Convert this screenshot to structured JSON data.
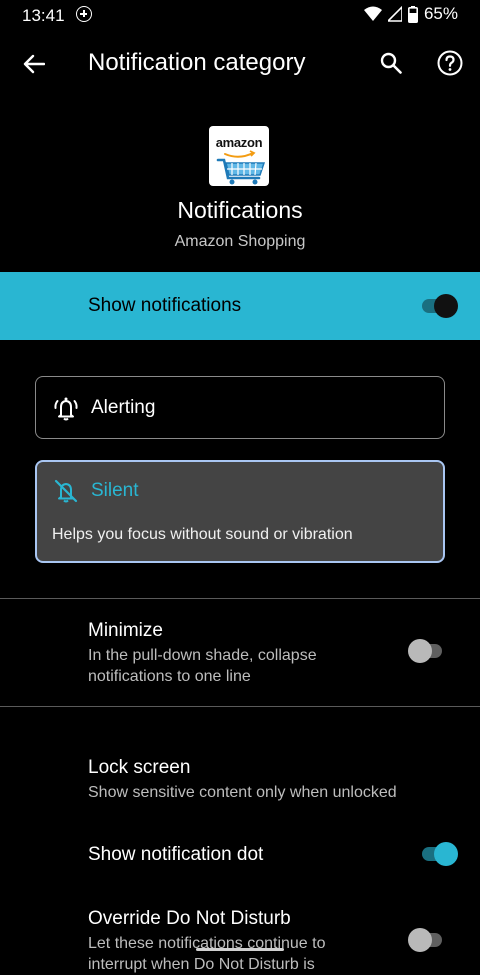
{
  "status_bar": {
    "time": "13:41",
    "battery": "65%"
  },
  "toolbar": {
    "title": "Notification category"
  },
  "app": {
    "logo_text": "amazon",
    "title": "Notifications",
    "name": "Amazon Shopping"
  },
  "show_notifications": {
    "label": "Show notifications",
    "enabled": true
  },
  "modes": {
    "alerting": {
      "label": "Alerting"
    },
    "silent": {
      "label": "Silent",
      "description": "Helps you focus without sound or vibration",
      "selected": true
    }
  },
  "settings": {
    "minimize": {
      "title": "Minimize",
      "subtitle_line1": "In the pull-down shade, collapse",
      "subtitle_line2": "notifications to one line",
      "enabled": false
    },
    "lock_screen": {
      "title": "Lock screen",
      "subtitle": "Show sensitive content only when unlocked"
    },
    "notification_dot": {
      "title": "Show notification dot",
      "enabled": true
    },
    "override_dnd": {
      "title": "Override Do Not Disturb",
      "subtitle_line1": "Let these notifications continue to",
      "subtitle_line2": "interrupt when Do Not Disturb is",
      "enabled": false
    }
  },
  "colors": {
    "accent": "#29b6d2",
    "background": "#000000",
    "card_selected": "#444444"
  }
}
